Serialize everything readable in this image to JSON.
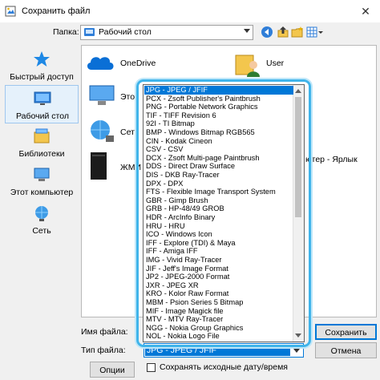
{
  "window": {
    "title": "Сохранить файл",
    "close_glyph": "✕"
  },
  "toolbar": {
    "folder_label": "Папка:",
    "folder_value": "Рабочий стол"
  },
  "places": [
    {
      "label": "Быстрый доступ",
      "icon": "star-icon"
    },
    {
      "label": "Рабочий стол",
      "icon": "desktop-icon"
    },
    {
      "label": "Библиотеки",
      "icon": "library-icon"
    },
    {
      "label": "Этот компьютер",
      "icon": "computer-icon"
    },
    {
      "label": "Сеть",
      "icon": "network-icon"
    }
  ],
  "files": [
    {
      "label": "OneDrive"
    },
    {
      "label": "User"
    },
    {
      "label": "Этот"
    },
    {
      "label": "Сеть"
    },
    {
      "label": "ЖМИ"
    },
    {
      "label": "ютер - Ярлык"
    }
  ],
  "filetypes": [
    "JPG - JPEG / JFIF",
    "PCX - Zsoft Publisher's Paintbrush",
    "PNG - Portable Network Graphics",
    "TIF - TIFF Revision 6",
    "92I - TI Bitmap",
    "BMP - Windows Bitmap RGB565",
    "CIN - Kodak Cineon",
    "CSV - CSV",
    "DCX - Zsoft Multi-page Paintbrush",
    "DDS - Direct Draw Surface",
    "DIS - DKB Ray-Tracer",
    "DPX - DPX",
    "FTS - Flexible Image Transport System",
    "GBR - Gimp Brush",
    "GRB - HP-48/49 GROB",
    "HDR - ArcInfo Binary",
    "HRU - HRU",
    "ICO - Windows Icon",
    "IFF - Explore (TDI) & Maya",
    "IFF - Amiga IFF",
    "IMG - Vivid Ray-Tracer",
    "JIF - Jeff's Image Format",
    "JP2 - JPEG-2000 Format",
    "JXR - JPEG XR",
    "KRO - Kolor Raw Format",
    "MBM - Psion Series 5 Bitmap",
    "MIF - Image Magick file",
    "MTV - MTV Ray-Tracer",
    "NGG - Nokia Group Graphics",
    "NOL - Nokia Logo File"
  ],
  "bottom": {
    "filename_label": "Имя файла:",
    "filetype_label": "Тип файла:",
    "filetype_value": "JPG - JPEG / JFIF",
    "filename_value": "",
    "save_button": "Сохранить",
    "cancel_button": "Отмена",
    "options_button": "Опции",
    "keep_dates_label": "Сохранять исходные дату/время"
  },
  "colors": {
    "accent": "#0078d7",
    "highlight_ring": "#40b4ea"
  }
}
